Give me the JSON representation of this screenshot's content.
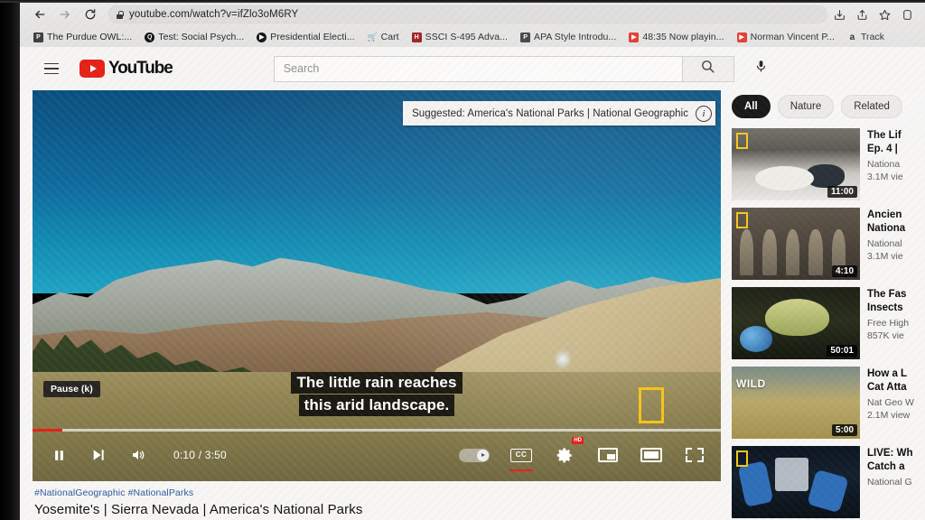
{
  "browser": {
    "url": "youtube.com/watch?v=ifZlo3oM6RY",
    "back_icon": "back-arrow-icon",
    "forward_icon": "forward-arrow-icon",
    "reload_icon": "reload-icon",
    "lock_icon": "lock-icon",
    "toolbar_icons": [
      "install-icon",
      "share-icon",
      "bookmark-star-icon",
      "profile-icon"
    ],
    "bookmarks": [
      {
        "label": "The Purdue OWL:...",
        "favicon": "purdue-owl-icon"
      },
      {
        "label": "Test: Social Psych...",
        "favicon": "quizlet-icon"
      },
      {
        "label": "Presidential Electi...",
        "favicon": "play-circle-icon"
      },
      {
        "label": "Cart",
        "favicon": "cart-icon"
      },
      {
        "label": "SSCI S-495 Adva...",
        "favicon": "harvard-shield-icon"
      },
      {
        "label": "APA Style Introdu...",
        "favicon": "purdue-owl-icon"
      },
      {
        "label": "48:35 Now playin...",
        "favicon": "youtube-icon"
      },
      {
        "label": "Norman Vincent P...",
        "favicon": "youtube-icon"
      },
      {
        "label": "Track",
        "favicon": "amazon-icon"
      }
    ]
  },
  "youtube": {
    "menu_icon": "hamburger-menu-icon",
    "logo_text": "YouTube",
    "search_placeholder": "Search",
    "search_value": "",
    "search_icon": "search-icon",
    "mic_icon": "microphone-icon",
    "player": {
      "suggested_label": "Suggested: America's National Parks | National Geographic",
      "info_icon": "info-icon",
      "caption_line_1": "The little rain reaches",
      "caption_line_2": "this arid landscape.",
      "tooltip": "Pause (k)",
      "current_time": "0:10",
      "duration": "3:50",
      "time_display": "0:10 / 3:50",
      "progress_percent": 4.3,
      "progress_color": "#e62117",
      "watermark": "natgeo-yellow-rectangle",
      "controls": {
        "pause_icon": "pause-icon",
        "next_icon": "next-video-icon",
        "volume_icon": "volume-icon",
        "autoplay_icon": "autoplay-toggle-on",
        "captions_icon": "closed-captions-icon",
        "captions_label": "CC",
        "captions_active": true,
        "settings_icon": "gear-icon",
        "quality_badge": "HD",
        "miniplayer_icon": "miniplayer-icon",
        "theater_icon": "theater-mode-icon",
        "fullscreen_icon": "fullscreen-icon"
      }
    },
    "meta": {
      "hashtags": "#NationalGeographic #NationalParks",
      "title": "Yosemite's | Sierra Nevada | America's National Parks"
    },
    "sidebar": {
      "chips": [
        {
          "label": "All",
          "active": true
        },
        {
          "label": "Nature",
          "active": false
        },
        {
          "label": "Related",
          "active": false
        }
      ],
      "recommendations": [
        {
          "title": "The Lif",
          "title2": "Ep. 4 |",
          "channel": "Nationa",
          "views": "3.1M vie",
          "duration": "11:00",
          "art": "art-bear",
          "natgeo": true
        },
        {
          "title": "Ancien",
          "title2": "Nationa",
          "channel": "National",
          "views": "3.1M vie",
          "duration": "4:10",
          "art": "art-egypt",
          "natgeo": true
        },
        {
          "title": "The Fas",
          "title2": "Insects",
          "channel": "Free High",
          "views": "857K vie",
          "duration": "50:01",
          "art": "art-mantis",
          "natgeo": false
        },
        {
          "title": "How a L",
          "title2": "Cat Atta",
          "channel": "Nat Geo W",
          "views": "2.1M view",
          "duration": "5:00",
          "art": "art-wild",
          "natgeo": false,
          "badge": "WILD"
        },
        {
          "title": "LIVE: Wh",
          "title2": "Catch a",
          "channel": "National G",
          "views": "",
          "duration": "",
          "art": "art-lab",
          "natgeo": true
        }
      ]
    }
  }
}
